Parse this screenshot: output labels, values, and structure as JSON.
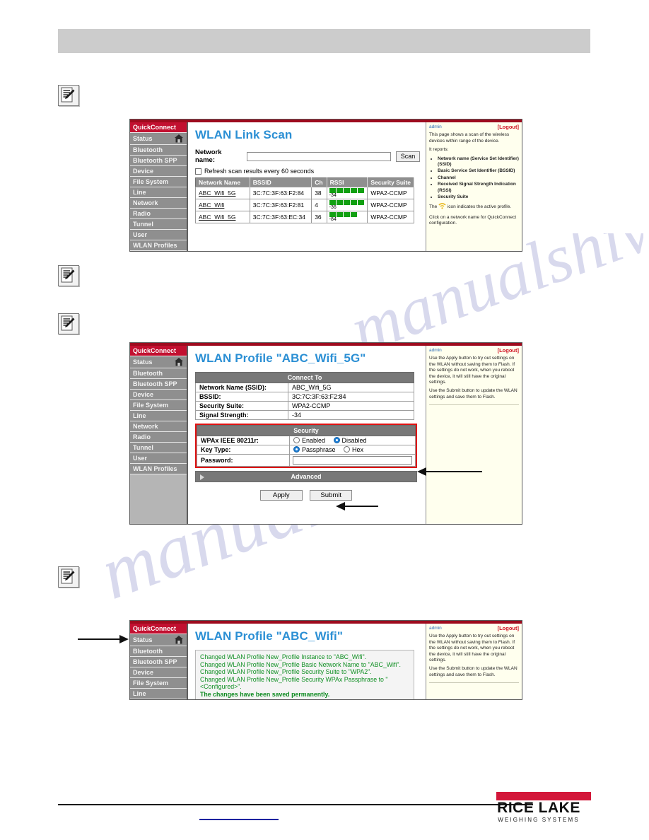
{
  "watermark": {
    "line1": "manualshive",
    "line2": "manualshive.com"
  },
  "footer": {
    "brand": "RICE LAKE",
    "tagline": "WEIGHING SYSTEMS"
  },
  "sidebar_full": {
    "items": [
      {
        "label": "QuickConnect",
        "kind": "quickconnect"
      },
      {
        "label": "Status",
        "kind": "status",
        "icon": "home-icon"
      },
      {
        "label": "Bluetooth",
        "kind": "plain"
      },
      {
        "label": "Bluetooth SPP",
        "kind": "plain"
      },
      {
        "label": "Device",
        "kind": "plain"
      },
      {
        "label": "File System",
        "kind": "plain"
      },
      {
        "label": "Line",
        "kind": "plain"
      },
      {
        "label": "Network",
        "kind": "plain"
      },
      {
        "label": "Radio",
        "kind": "plain"
      },
      {
        "label": "Tunnel",
        "kind": "plain"
      },
      {
        "label": "User",
        "kind": "plain"
      },
      {
        "label": "WLAN Profiles",
        "kind": "plain"
      }
    ]
  },
  "sidebar_short": {
    "items": [
      {
        "label": "QuickConnect"
      },
      {
        "label": "Status"
      },
      {
        "label": "Bluetooth"
      },
      {
        "label": "Bluetooth SPP"
      },
      {
        "label": "Device"
      },
      {
        "label": "File System"
      },
      {
        "label": "Line"
      }
    ]
  },
  "screen1": {
    "title": "WLAN Link Scan",
    "network_name_label": "Network name:",
    "network_name_value": "",
    "network_name_placeholder": "",
    "scan_button": "Scan",
    "refresh_checkbox_label": "Refresh scan results every 60 seconds",
    "refresh_checked": false,
    "table": {
      "headers": [
        "Network Name",
        "BSSID",
        "Ch",
        "RSSI",
        "Security Suite"
      ],
      "rows": [
        {
          "name": "ABC_Wifi_5G",
          "bssid": "3C:7C:3F:63:F2:84",
          "ch": "38",
          "rssi": "-34",
          "bars": 5,
          "suite": "WPA2-CCMP"
        },
        {
          "name": "ABC_Wifi",
          "bssid": "3C:7C:3F:63:F2:81",
          "ch": "4",
          "rssi": "-36",
          "bars": 5,
          "suite": "WPA2-CCMP"
        },
        {
          "name": "ABC_Wifi_5G",
          "bssid": "3C:7C:3F:63:EC:34",
          "ch": "36",
          "rssi": "-84",
          "bars": 4,
          "suite": "WPA2-CCMP"
        }
      ]
    },
    "help": {
      "admin": "admin",
      "logout": "[Logout]",
      "p1": "This page shows a scan of the wireless devices within range of the device.",
      "p2": "It reports:",
      "bullets": [
        "Network name (Service Set Identifier)(SSID)",
        "Basic Service Set Identifier (BSSID)",
        "Channel",
        "Received Signal Strength Indication (RSSI)",
        "Security Suite"
      ],
      "p3_before": "The",
      "p3_after": "icon indicates the active profile.",
      "p4": "Click on a network name for QuickConnect configuration."
    }
  },
  "screen2": {
    "title": "WLAN Profile \"ABC_Wifi_5G\"",
    "connect_to_header": "Connect To",
    "fields": [
      {
        "label": "Network Name (SSID):",
        "value": "ABC_Wifi_5G"
      },
      {
        "label": "BSSID:",
        "value": "3C:7C:3F:63:F2:84"
      },
      {
        "label": "Security Suite:",
        "value": "WPA2-CCMP"
      },
      {
        "label": "Signal Strength:",
        "value": "-34"
      }
    ],
    "security_header": "Security",
    "wpax_label": "WPAx IEEE 80211r:",
    "wpax_options": [
      {
        "label": "Enabled",
        "selected": false
      },
      {
        "label": "Disabled",
        "selected": true
      }
    ],
    "keytype_label": "Key Type:",
    "keytype_options": [
      {
        "label": "Passphrase",
        "selected": true
      },
      {
        "label": "Hex",
        "selected": false
      }
    ],
    "password_label": "Password:",
    "password_value": "",
    "advanced_label": "Advanced",
    "apply_button": "Apply",
    "submit_button": "Submit",
    "help": {
      "admin": "admin",
      "logout": "[Logout]",
      "p1": "Use the Apply button to try out settings on the WLAN without saving them to Flash. If the settings do not work, when you reboot the device, it will still have the original settings.",
      "p2": "Use the Submit button to update the WLAN settings and save them to Flash."
    }
  },
  "screen3": {
    "title": "WLAN Profile \"ABC_Wifi\"",
    "messages": [
      "Changed WLAN Profile New_Profile Instance to \"ABC_Wifi\".",
      "Changed WLAN Profile New_Profile Basic Network Name to \"ABC_Wifi\".",
      "Changed WLAN Profile New_Profile Security Suite to \"WPA2\".",
      "Changed WLAN Profile New_Profile Security WPAx Passphrase to \" <Configured>\".",
      "The changes have been saved permanently."
    ],
    "help": {
      "admin": "admin",
      "logout": "[Logout]",
      "p1": "Use the Apply button to try out settings on the WLAN without saving them to Flash. If the settings do not work, when you reboot the device, it will still have the original settings.",
      "p2": "Use the Submit button to update the WLAN settings and save them to Flash."
    }
  },
  "colors": {
    "accent_red": "#c21030",
    "title_blue": "#2b8fd4",
    "signal_green": "#12a012",
    "highlight_red": "#e01111"
  }
}
